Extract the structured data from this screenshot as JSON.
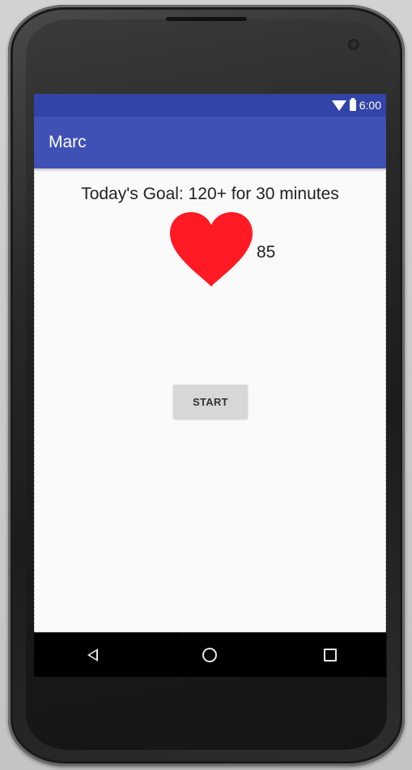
{
  "status_bar": {
    "time": "6:00",
    "icons": [
      "wifi-icon",
      "battery-icon"
    ]
  },
  "app_bar": {
    "title": "Marc"
  },
  "main": {
    "goal_text": "Today's Goal: 120+ for 30 minutes",
    "heart_rate": "85",
    "start_button_label": "START"
  },
  "nav_bar": {
    "icons": [
      "back-icon",
      "home-icon",
      "recents-icon"
    ]
  },
  "colors": {
    "status_bar": "#3344a8",
    "app_bar": "#3f51b5",
    "heart": "#ff1a24",
    "button": "#d6d7d7",
    "background": "#fafafa"
  }
}
